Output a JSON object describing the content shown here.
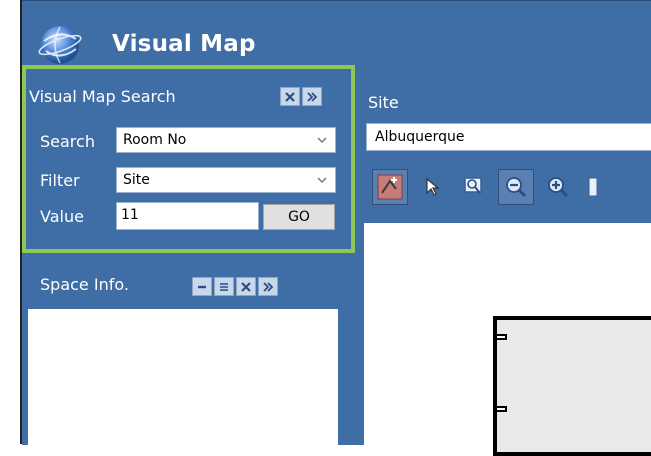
{
  "app": {
    "title": "Visual Map"
  },
  "search_panel": {
    "title": "Visual Map Search",
    "search_label": "Search",
    "search_value": "Room No",
    "filter_label": "Filter",
    "filter_value": "Site",
    "value_label": "Value",
    "value_input": "11",
    "go_label": "GO"
  },
  "info_panel": {
    "title": "Space Info."
  },
  "site_panel": {
    "label": "Site",
    "selected": "Albuquerque"
  },
  "colors": {
    "header": "#3f6da5",
    "highlight": "#8fc655"
  },
  "icons": [
    "globe-icon",
    "close-icon",
    "expand-icon",
    "minus-icon",
    "list-icon",
    "zoom-region-icon",
    "pointer-icon",
    "zoom-window-icon",
    "zoom-out-icon",
    "zoom-in-icon",
    "chevron-down-icon"
  ]
}
